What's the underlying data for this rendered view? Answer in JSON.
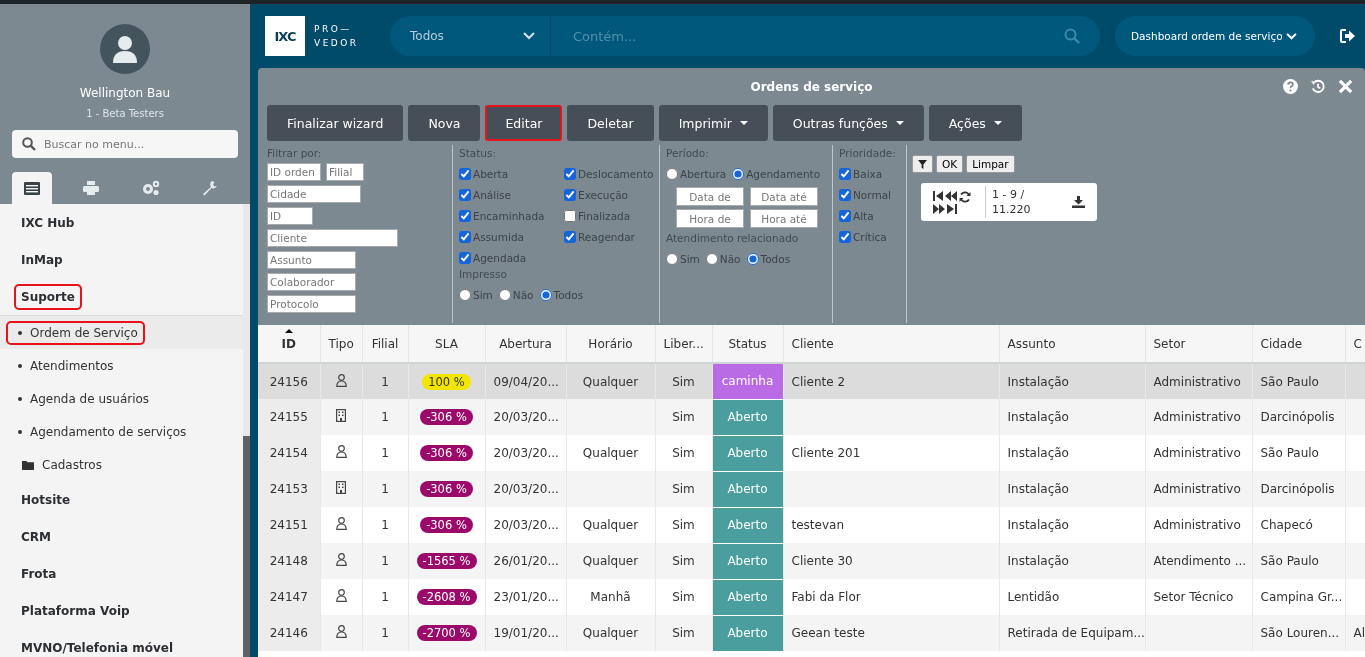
{
  "sidebar": {
    "user": {
      "name": "Wellington Bau",
      "group": "1 - Beta Testers"
    },
    "search": {
      "placeholder": "Buscar no menu..."
    },
    "tabs": [
      {
        "kind": "list",
        "selected": true
      },
      {
        "kind": "printer",
        "selected": false
      },
      {
        "kind": "gears",
        "selected": false
      },
      {
        "kind": "wrench",
        "selected": false
      }
    ],
    "menu": [
      {
        "label": "IXC Hub",
        "highlighted": false
      },
      {
        "label": "InMap",
        "highlighted": false
      },
      {
        "label": "Suporte",
        "highlighted": true,
        "children": [
          {
            "label": "Ordem de Serviço",
            "kind": "page",
            "selected": true,
            "highlighted": true
          },
          {
            "label": "Atendimentos",
            "kind": "page",
            "selected": false,
            "highlighted": false
          },
          {
            "label": "Agenda de usuários",
            "kind": "page",
            "selected": false,
            "highlighted": false
          },
          {
            "label": "Agendamento de serviços",
            "kind": "page",
            "selected": false,
            "highlighted": false
          },
          {
            "label": "Cadastros",
            "kind": "folder",
            "selected": false,
            "highlighted": false
          }
        ]
      },
      {
        "label": "Hotsite",
        "highlighted": false
      },
      {
        "label": "CRM",
        "highlighted": false
      },
      {
        "label": "Frota",
        "highlighted": false
      },
      {
        "label": "Plataforma Voip",
        "highlighted": false
      },
      {
        "label": "MVNO/Telefonia móvel",
        "highlighted": false
      }
    ]
  },
  "header": {
    "logo": {
      "mark": "IXC",
      "line1": "PRO—",
      "line2": "VEDOR"
    },
    "search": {
      "scope": "Todos",
      "placeholder": "Contém..."
    },
    "dashboard": "Dashboard ordem de serviço"
  },
  "panel": {
    "title": "Ordens de serviço",
    "toolbar": [
      {
        "label": "Finalizar wizard",
        "dropdown": false,
        "highlighted": false
      },
      {
        "label": "Nova",
        "dropdown": false,
        "highlighted": false
      },
      {
        "label": "Editar",
        "dropdown": false,
        "highlighted": true
      },
      {
        "label": "Deletar",
        "dropdown": false,
        "highlighted": false
      },
      {
        "label": "Imprimir",
        "dropdown": true,
        "highlighted": false
      },
      {
        "label": "Outras funções",
        "dropdown": true,
        "highlighted": false
      },
      {
        "label": "Ações",
        "dropdown": true,
        "highlighted": false
      }
    ],
    "filters": {
      "heading": "Filtrar por:",
      "fields": [
        {
          "placeholder": "ID orden"
        },
        {
          "placeholder": "Filial"
        },
        {
          "placeholder": "Cidade"
        },
        {
          "placeholder": "ID"
        },
        {
          "placeholder": "Cliente"
        },
        {
          "placeholder": "Assunto"
        },
        {
          "placeholder": "Colaborador"
        },
        {
          "placeholder": "Protocolo"
        }
      ],
      "status": {
        "heading": "Status:",
        "options": [
          {
            "label": "Aberta",
            "checked": true
          },
          {
            "label": "Análise",
            "checked": true
          },
          {
            "label": "Encaminhada",
            "checked": true
          },
          {
            "label": "Assumida",
            "checked": true
          },
          {
            "label": "Agendada",
            "checked": true
          },
          {
            "label": "Deslocamento",
            "checked": true
          },
          {
            "label": "Execução",
            "checked": true
          },
          {
            "label": "Finalizada",
            "checked": false
          },
          {
            "label": "Reagendar",
            "checked": true
          }
        ]
      },
      "impresso": {
        "heading": "Impresso",
        "options": [
          {
            "label": "Sim",
            "selected": false
          },
          {
            "label": "Não",
            "selected": false
          },
          {
            "label": "Todos",
            "selected": true
          }
        ]
      },
      "periodo": {
        "heading": "Período:",
        "options": [
          {
            "label": "Abertura",
            "selected": false
          },
          {
            "label": "Agendamento",
            "selected": true
          }
        ],
        "fields": [
          {
            "placeholder": "Data de"
          },
          {
            "placeholder": "Data até"
          },
          {
            "placeholder": "Hora de"
          },
          {
            "placeholder": "Hora até"
          }
        ]
      },
      "atendimento": {
        "heading": "Atendimento relacionado",
        "options": [
          {
            "label": "Sim",
            "selected": false
          },
          {
            "label": "Não",
            "selected": false
          },
          {
            "label": "Todos",
            "selected": true
          }
        ]
      },
      "prioridade": {
        "heading": "Prioridade:",
        "options": [
          {
            "label": "Baixa",
            "checked": true
          },
          {
            "label": "Normal",
            "checked": true
          },
          {
            "label": "Alta",
            "checked": true
          },
          {
            "label": "Crítica",
            "checked": true
          }
        ]
      },
      "ok": "OK",
      "clear": "Limpar",
      "pager": "1 - 9 / 11.220"
    },
    "table": {
      "columns": [
        "ID",
        "Tipo",
        "Filial",
        "SLA",
        "Abertura",
        "Horário",
        "Liber...",
        "Status",
        "Cliente",
        "Assunto",
        "Setor",
        "Cidade",
        "C"
      ],
      "rows": [
        {
          "id": "24156",
          "kind": "person",
          "filial": "1",
          "sla": {
            "text": "100 %",
            "color": "#f2e600"
          },
          "abertura": "09/04/20...",
          "horario": "Qualquer",
          "liberado": "Sim",
          "status": {
            "text": "caminha",
            "color": "#b96be6"
          },
          "cliente": "Cliente 2",
          "assunto": "Instalação",
          "setor": "Administrativo",
          "cidade": "São Paulo",
          "selected": true
        },
        {
          "id": "24155",
          "kind": "building",
          "filial": "1",
          "sla": {
            "text": "-306 %",
            "color": "#9b0a6a"
          },
          "abertura": "20/03/20...",
          "liberado": "Sim",
          "status": {
            "text": "Aberto",
            "color": "#4a9e9e"
          },
          "assunto": "Instalação",
          "setor": "Administrativo",
          "cidade": "Darcinópolis",
          "selected": false
        },
        {
          "id": "24154",
          "kind": "person",
          "filial": "1",
          "sla": {
            "text": "-306 %",
            "color": "#9b0a6a"
          },
          "abertura": "20/03/20...",
          "horario": "Qualquer",
          "liberado": "Sim",
          "status": {
            "text": "Aberto",
            "color": "#4a9e9e"
          },
          "cliente": "Cliente 201",
          "assunto": "Instalação",
          "setor": "Administrativo",
          "cidade": "São Paulo",
          "selected": false
        },
        {
          "id": "24153",
          "kind": "building",
          "filial": "1",
          "sla": {
            "text": "-306 %",
            "color": "#9b0a6a"
          },
          "abertura": "20/03/20...",
          "liberado": "Sim",
          "status": {
            "text": "Aberto",
            "color": "#4a9e9e"
          },
          "assunto": "Instalação",
          "setor": "Administrativo",
          "cidade": "Darcinópolis",
          "selected": false
        },
        {
          "id": "24151",
          "kind": "person",
          "filial": "1",
          "sla": {
            "text": "-306 %",
            "color": "#9b0a6a"
          },
          "abertura": "20/03/20...",
          "horario": "Qualquer",
          "liberado": "Sim",
          "status": {
            "text": "Aberto",
            "color": "#4a9e9e"
          },
          "cliente": "testevan",
          "assunto": "Instalação",
          "setor": "Administrativo",
          "cidade": "Chapecó",
          "selected": false
        },
        {
          "id": "24148",
          "kind": "person",
          "filial": "1",
          "sla": {
            "text": "-1565 %",
            "color": "#9b0a6a"
          },
          "abertura": "26/01/20...",
          "horario": "Qualquer",
          "liberado": "Sim",
          "status": {
            "text": "Aberto",
            "color": "#4a9e9e"
          },
          "cliente": "Cliente 30",
          "assunto": "Instalação",
          "setor": "Atendimento ...",
          "cidade": "São Paulo",
          "selected": false
        },
        {
          "id": "24147",
          "kind": "person",
          "filial": "1",
          "sla": {
            "text": "-2608 %",
            "color": "#9b0a6a"
          },
          "abertura": "23/01/20...",
          "horario": "Manhã",
          "liberado": "Sim",
          "status": {
            "text": "Aberto",
            "color": "#4a9e9e"
          },
          "cliente": "Fabi da Flor",
          "assunto": "Lentidão",
          "setor": "Setor Técnico",
          "cidade": "Campina Gr...",
          "selected": false
        },
        {
          "id": "24146",
          "kind": "person",
          "filial": "1",
          "sla": {
            "text": "-2700 %",
            "color": "#9b0a6a"
          },
          "abertura": "19/01/20...",
          "horario": "Qualquer",
          "liberado": "Sim",
          "status": {
            "text": "Aberto",
            "color": "#4a9e9e"
          },
          "cliente": "Geean teste",
          "assunto": "Retirada de Equipam...",
          "cidade": "São Louren...",
          "column_13": "Al",
          "selected": false
        }
      ]
    }
  }
}
